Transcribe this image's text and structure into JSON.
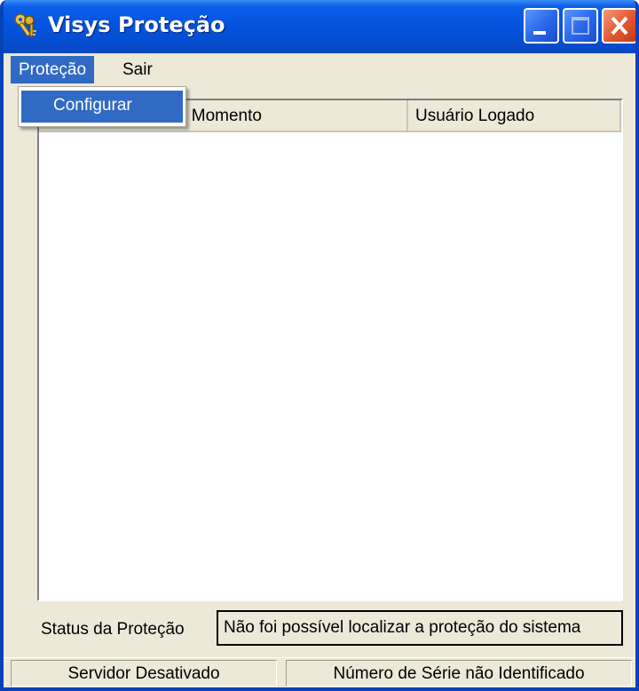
{
  "window": {
    "title": "Visys Proteção",
    "title_icon": "keys-icon"
  },
  "menubar": {
    "items": [
      {
        "label": "Proteção",
        "active": true
      },
      {
        "label": "Sair",
        "active": false
      }
    ]
  },
  "dropdown": {
    "items": [
      {
        "label": "Configurar",
        "highlighted": true
      }
    ]
  },
  "list": {
    "columns": [
      {
        "label": "as no Momento"
      },
      {
        "label": "Usuário Logado"
      }
    ],
    "rows": []
  },
  "status": {
    "label": "Status da Proteção",
    "value": "Não foi possível localizar a proteção do sistema"
  },
  "statusbar": {
    "panes": [
      {
        "text": "Servidor Desativado"
      },
      {
        "text": "Número de Série não Identificado"
      }
    ]
  },
  "colors": {
    "titlebar": "#0553e0",
    "highlight": "#316ac5",
    "window_bg": "#ece9d8",
    "close_button": "#e2562f"
  }
}
